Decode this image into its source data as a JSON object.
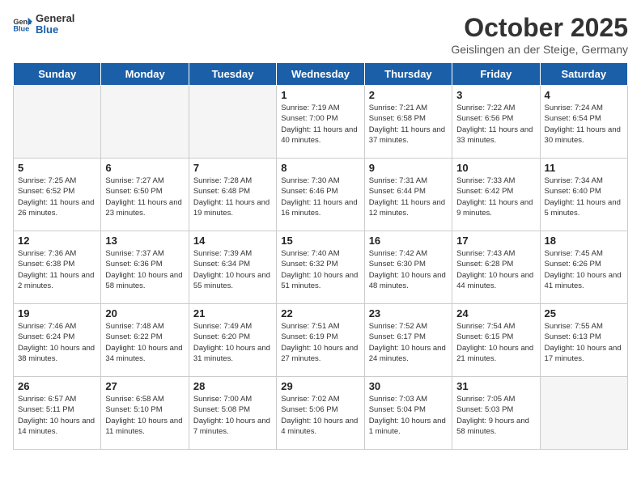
{
  "header": {
    "logo_general": "General",
    "logo_blue": "Blue",
    "title": "October 2025",
    "subtitle": "Geislingen an der Steige, Germany"
  },
  "days": [
    "Sunday",
    "Monday",
    "Tuesday",
    "Wednesday",
    "Thursday",
    "Friday",
    "Saturday"
  ],
  "weeks": [
    [
      {
        "num": "",
        "info": ""
      },
      {
        "num": "",
        "info": ""
      },
      {
        "num": "",
        "info": ""
      },
      {
        "num": "1",
        "info": "Sunrise: 7:19 AM\nSunset: 7:00 PM\nDaylight: 11 hours and 40 minutes."
      },
      {
        "num": "2",
        "info": "Sunrise: 7:21 AM\nSunset: 6:58 PM\nDaylight: 11 hours and 37 minutes."
      },
      {
        "num": "3",
        "info": "Sunrise: 7:22 AM\nSunset: 6:56 PM\nDaylight: 11 hours and 33 minutes."
      },
      {
        "num": "4",
        "info": "Sunrise: 7:24 AM\nSunset: 6:54 PM\nDaylight: 11 hours and 30 minutes."
      }
    ],
    [
      {
        "num": "5",
        "info": "Sunrise: 7:25 AM\nSunset: 6:52 PM\nDaylight: 11 hours and 26 minutes."
      },
      {
        "num": "6",
        "info": "Sunrise: 7:27 AM\nSunset: 6:50 PM\nDaylight: 11 hours and 23 minutes."
      },
      {
        "num": "7",
        "info": "Sunrise: 7:28 AM\nSunset: 6:48 PM\nDaylight: 11 hours and 19 minutes."
      },
      {
        "num": "8",
        "info": "Sunrise: 7:30 AM\nSunset: 6:46 PM\nDaylight: 11 hours and 16 minutes."
      },
      {
        "num": "9",
        "info": "Sunrise: 7:31 AM\nSunset: 6:44 PM\nDaylight: 11 hours and 12 minutes."
      },
      {
        "num": "10",
        "info": "Sunrise: 7:33 AM\nSunset: 6:42 PM\nDaylight: 11 hours and 9 minutes."
      },
      {
        "num": "11",
        "info": "Sunrise: 7:34 AM\nSunset: 6:40 PM\nDaylight: 11 hours and 5 minutes."
      }
    ],
    [
      {
        "num": "12",
        "info": "Sunrise: 7:36 AM\nSunset: 6:38 PM\nDaylight: 11 hours and 2 minutes."
      },
      {
        "num": "13",
        "info": "Sunrise: 7:37 AM\nSunset: 6:36 PM\nDaylight: 10 hours and 58 minutes."
      },
      {
        "num": "14",
        "info": "Sunrise: 7:39 AM\nSunset: 6:34 PM\nDaylight: 10 hours and 55 minutes."
      },
      {
        "num": "15",
        "info": "Sunrise: 7:40 AM\nSunset: 6:32 PM\nDaylight: 10 hours and 51 minutes."
      },
      {
        "num": "16",
        "info": "Sunrise: 7:42 AM\nSunset: 6:30 PM\nDaylight: 10 hours and 48 minutes."
      },
      {
        "num": "17",
        "info": "Sunrise: 7:43 AM\nSunset: 6:28 PM\nDaylight: 10 hours and 44 minutes."
      },
      {
        "num": "18",
        "info": "Sunrise: 7:45 AM\nSunset: 6:26 PM\nDaylight: 10 hours and 41 minutes."
      }
    ],
    [
      {
        "num": "19",
        "info": "Sunrise: 7:46 AM\nSunset: 6:24 PM\nDaylight: 10 hours and 38 minutes."
      },
      {
        "num": "20",
        "info": "Sunrise: 7:48 AM\nSunset: 6:22 PM\nDaylight: 10 hours and 34 minutes."
      },
      {
        "num": "21",
        "info": "Sunrise: 7:49 AM\nSunset: 6:20 PM\nDaylight: 10 hours and 31 minutes."
      },
      {
        "num": "22",
        "info": "Sunrise: 7:51 AM\nSunset: 6:19 PM\nDaylight: 10 hours and 27 minutes."
      },
      {
        "num": "23",
        "info": "Sunrise: 7:52 AM\nSunset: 6:17 PM\nDaylight: 10 hours and 24 minutes."
      },
      {
        "num": "24",
        "info": "Sunrise: 7:54 AM\nSunset: 6:15 PM\nDaylight: 10 hours and 21 minutes."
      },
      {
        "num": "25",
        "info": "Sunrise: 7:55 AM\nSunset: 6:13 PM\nDaylight: 10 hours and 17 minutes."
      }
    ],
    [
      {
        "num": "26",
        "info": "Sunrise: 6:57 AM\nSunset: 5:11 PM\nDaylight: 10 hours and 14 minutes."
      },
      {
        "num": "27",
        "info": "Sunrise: 6:58 AM\nSunset: 5:10 PM\nDaylight: 10 hours and 11 minutes."
      },
      {
        "num": "28",
        "info": "Sunrise: 7:00 AM\nSunset: 5:08 PM\nDaylight: 10 hours and 7 minutes."
      },
      {
        "num": "29",
        "info": "Sunrise: 7:02 AM\nSunset: 5:06 PM\nDaylight: 10 hours and 4 minutes."
      },
      {
        "num": "30",
        "info": "Sunrise: 7:03 AM\nSunset: 5:04 PM\nDaylight: 10 hours and 1 minute."
      },
      {
        "num": "31",
        "info": "Sunrise: 7:05 AM\nSunset: 5:03 PM\nDaylight: 9 hours and 58 minutes."
      },
      {
        "num": "",
        "info": ""
      }
    ]
  ]
}
